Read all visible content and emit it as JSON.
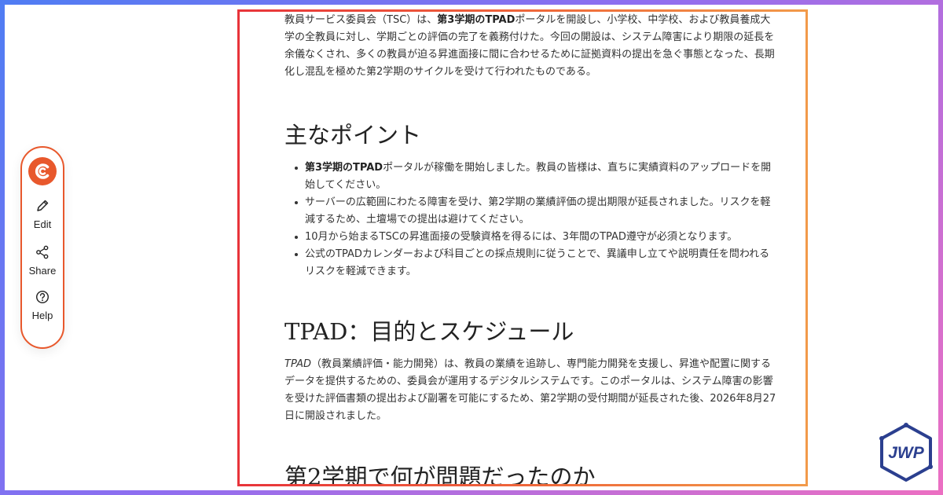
{
  "toolbar": {
    "logo_icon": "brand-c-logo",
    "accent_color": "#e8582c",
    "edit_label": "Edit",
    "share_label": "Share",
    "help_label": "Help"
  },
  "article": {
    "intro": {
      "p1": "教員サービス委員会（TSC）は、",
      "b1": "第3学期のTPAD",
      "p2": "ポータルを開設し、小学校、中学校、および教員養成大学の全教員に対し、学期ごとの評価の完了を義務付けた。今回の開設は、システム障害により期限の延長を余儀なくされ、多くの教員が迫る昇進面接に間に合わせるために証拠資料の提出を急ぐ事態となった、長期化し混乱を極めた第2学期のサイクルを受けて行われたものである。"
    },
    "heading_points": "主なポイント",
    "bullets": {
      "b1_bold": "第3学期のTPAD",
      "b1_rest": "ポータルが稼働を開始しました。教員の皆様は、直ちに実績資料のアップロードを開始してください。",
      "b2": "サーバーの広範囲にわたる障害を受け、第2学期の業績評価の提出期限が延長されました。リスクを軽減するため、土壇場での提出は避けてください。",
      "b3": "10月から始まるTSCの昇進面接の受験資格を得るには、3年間のTPAD遵守が必須となります。",
      "b4": "公式のTPADカレンダーおよび科目ごとの採点規則に従うことで、異議申し立てや説明責任を問われるリスクを軽減できます。"
    },
    "heading_tpad": "TPAD：目的とスケジュール",
    "tpad_para": {
      "italic": "TPAD",
      "rest": "（教員業績評価・能力開発）は、教員の業績を追跡し、専門能力開発を支援し、昇進や配置に関するデータを提供するための、委員会が運用するデジタルシステムです。このポータルは、システム障害の影響を受けた評価書類の提出および副署を可能にするため、第2学期の受付期間が延長された後、2026年8月27日に開設されました。"
    },
    "heading_issue": "第2学期で何が問題だったのか"
  },
  "badge": {
    "text": "JWP",
    "color": "#2b3f8f"
  }
}
